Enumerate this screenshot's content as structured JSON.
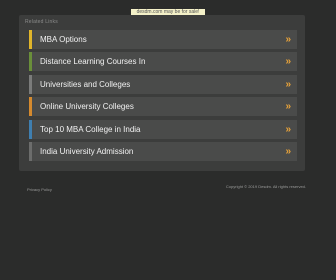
{
  "banner": {
    "text": "desdm.com may be for sale!",
    "color": "#f4f1c8"
  },
  "panel": {
    "title": "Related Links"
  },
  "links": [
    {
      "label": "MBA Options",
      "accent": "#e0b52a"
    },
    {
      "label": "Distance Learning Courses In",
      "accent": "#6a8f3a"
    },
    {
      "label": "Universities and Colleges",
      "accent": "#7b7c7b"
    },
    {
      "label": "Online University Colleges",
      "accent": "#d58a2e"
    },
    {
      "label": "Top 10 MBA College in India",
      "accent": "#3f7fb0"
    },
    {
      "label": "India University Admission",
      "accent": "#6c6d6c"
    }
  ],
  "chevron_icon": "double-chevron-right",
  "chevron_glyph": "»",
  "footer": {
    "privacy": "Privacy Policy",
    "copyright": "Copyright © 2019 Desdm. All rights reserved."
  }
}
